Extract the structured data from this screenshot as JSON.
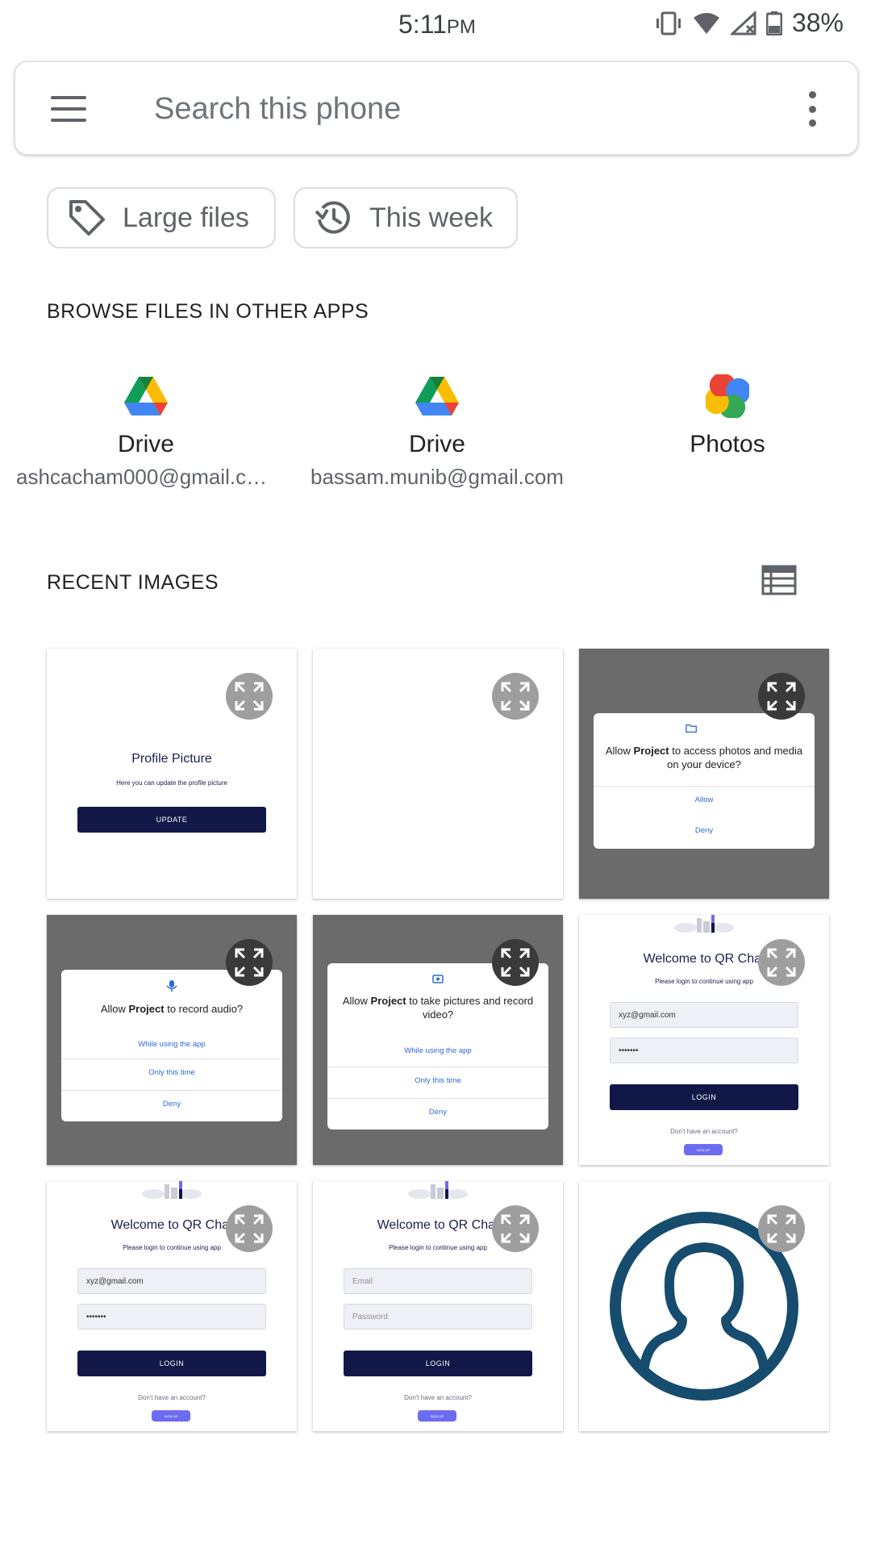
{
  "status_bar": {
    "time": "5:11",
    "ampm": "PM",
    "battery": "38%"
  },
  "search": {
    "placeholder": "Search this phone"
  },
  "chips": {
    "large_files": "Large files",
    "this_week": "This week"
  },
  "browse": {
    "heading": "BROWSE FILES IN OTHER APPS",
    "apps": [
      {
        "name": "Drive",
        "account": "ashcacham000@gmail.co…"
      },
      {
        "name": "Drive",
        "account": "bassam.munib@gmail.com"
      },
      {
        "name": "Photos",
        "account": ""
      }
    ]
  },
  "recent": {
    "heading": "RECENT IMAGES",
    "profile": {
      "title": "Profile Picture",
      "subtitle": "Here you can update the profile picture",
      "button": "UPDATE"
    },
    "photos_dialog": {
      "text_pre": "Allow ",
      "text_bold": "Project",
      "text_post": " to access photos and media on your device?",
      "allow": "Allow",
      "deny": "Deny"
    },
    "audio_dialog": {
      "text_pre": "Allow ",
      "text_bold": "Project",
      "text_post": " to record audio?",
      "while_using": "While using the app",
      "only_this_time": "Only this time",
      "deny": "Deny"
    },
    "camera_dialog": {
      "text_pre": "Allow ",
      "text_bold": "Project",
      "text_post": " to take pictures and record video?",
      "while_using": "While using the app",
      "only_this_time": "Only this time",
      "deny": "Deny"
    },
    "login": {
      "title": "Welcome to QR Chat",
      "subtitle": "Please login to continue using app",
      "email_value": "xyz@gmail.com",
      "password_value": "•••••••",
      "email_placeholder": "Email",
      "password_placeholder": "Password",
      "login_button": "LOGIN",
      "no_account": "Don't have an account?",
      "signup": "SIGN UP"
    }
  },
  "colors": {
    "accent_navy": "#111848",
    "link_blue": "#2d6bd6",
    "avatar_teal": "#164c6e",
    "dim_overlay": "#6b6b6b"
  }
}
